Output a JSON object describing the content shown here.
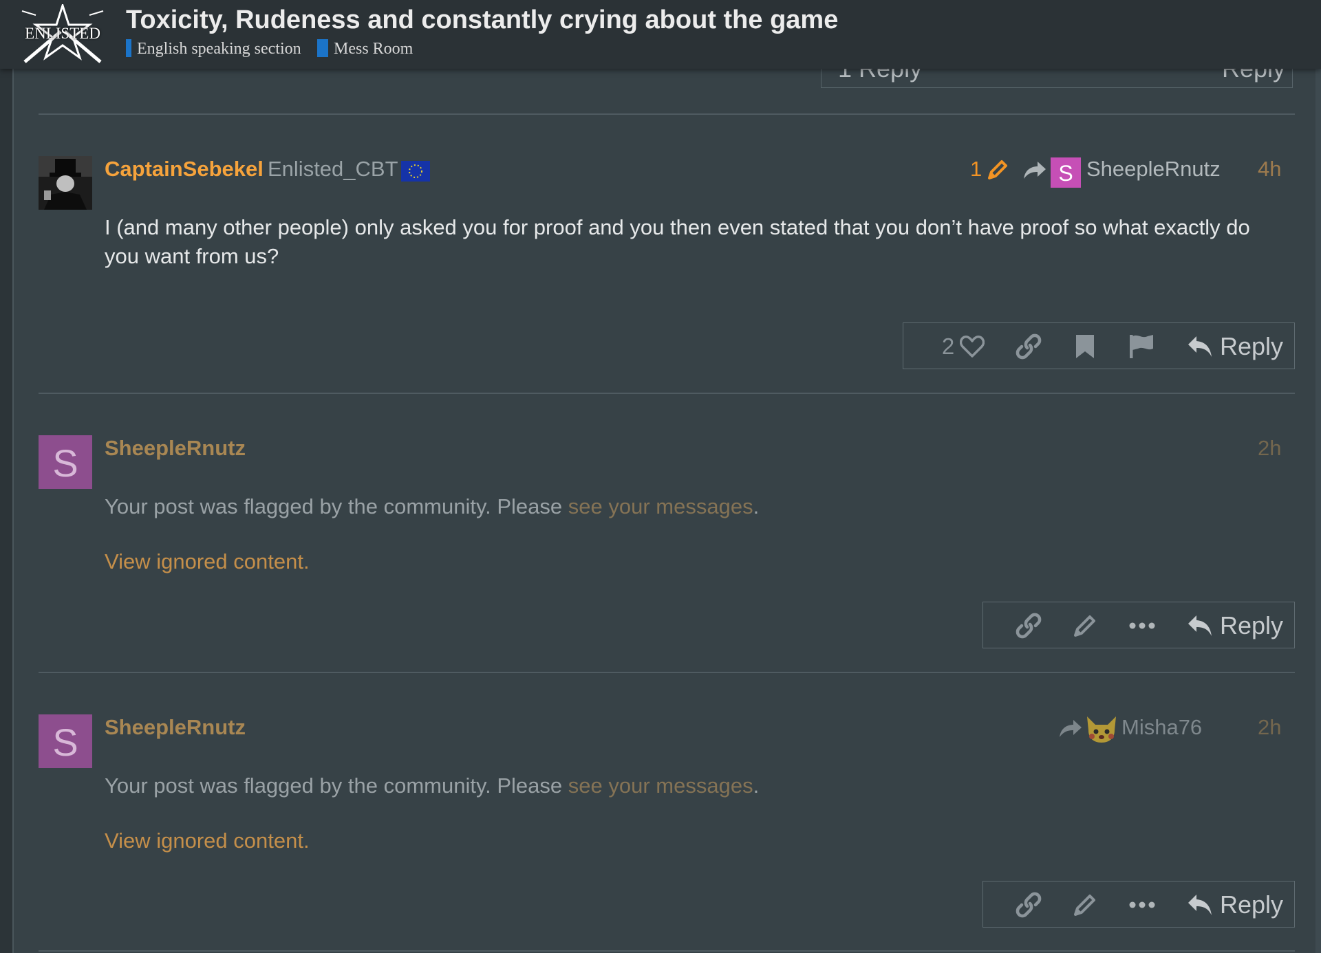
{
  "header": {
    "logo_text": "ENLISTED",
    "title": "Toxicity, Rudeness and constantly crying about the game",
    "breadcrumbs": [
      "English speaking section",
      "Mess Room"
    ]
  },
  "previous_post": {
    "replies_label": "1 Reply",
    "reply_label": "Reply"
  },
  "posts": [
    {
      "username": "CaptainSebekel",
      "user_title": "Enlisted_CBT",
      "edit_count": "1",
      "reply_to": {
        "avatar_letter": "S",
        "name": "SheepleRnutz"
      },
      "time": "4h",
      "body": "I (and many other people) only asked you for proof and you then even stated that you don’t have proof so what exactly do you want from us?",
      "like_count": "2",
      "reply_label": "Reply"
    },
    {
      "avatar_letter": "S",
      "username": "SheepleRnutz",
      "time": "2h",
      "body_prefix": "Your post was flagged by the community. Please ",
      "body_link": "see your messages",
      "body_suffix": ".",
      "ignored_link": "View ignored content.",
      "reply_label": "Reply"
    },
    {
      "avatar_letter": "S",
      "username": "SheepleRnutz",
      "reply_to": {
        "name": "Misha76"
      },
      "time": "2h",
      "body_prefix": "Your post was flagged by the community. Please ",
      "body_link": "see your messages",
      "body_suffix": ".",
      "ignored_link": "View ignored content.",
      "reply_label": "Reply"
    }
  ],
  "colors": {
    "background": "#374247",
    "header_bg": "#2b3236",
    "username_staff": "#f6a33c",
    "username_muted": "#a98753",
    "link_orange": "#c58f4a",
    "category_blue": "#1b74c9",
    "avatar_purple": "#8d4e8e"
  },
  "icons": [
    "heart-icon",
    "link-icon",
    "bookmark-icon",
    "flag-icon",
    "reply-icon",
    "pencil-icon",
    "share-arrow-icon",
    "more-dots-icon",
    "eu-flag-icon"
  ]
}
